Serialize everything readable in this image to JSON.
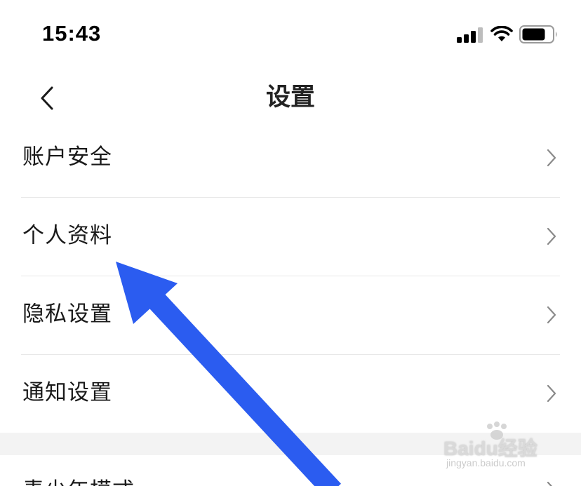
{
  "status_bar": {
    "time": "15:43"
  },
  "nav": {
    "title": "设置"
  },
  "settings": {
    "items": [
      {
        "label": "账户安全"
      },
      {
        "label": "个人资料"
      },
      {
        "label": "隐私设置"
      },
      {
        "label": "通知设置"
      }
    ],
    "partial_item_label": "青少年模式"
  },
  "watermark": {
    "brand": "Baidu经验",
    "url": "jingyan.baidu.com"
  },
  "colors": {
    "arrow": "#2b5cf0",
    "divider": "#e8e8e8",
    "section_gap": "#f3f3f3"
  },
  "icons": {
    "back": "chevron-left-icon",
    "row": "chevron-right-icon"
  }
}
